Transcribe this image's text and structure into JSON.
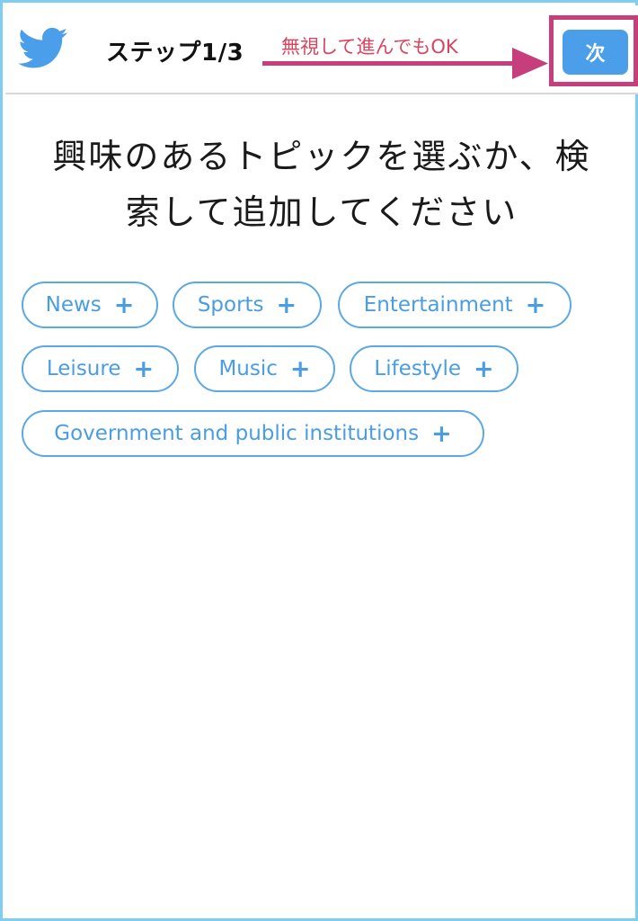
{
  "header": {
    "step_title": "ステップ1/3",
    "annotation": "無視して進んでもOK",
    "next_label": "次"
  },
  "heading": {
    "line1": "興味のあるトピックを選ぶか、検",
    "line2": "索して追加してください"
  },
  "topics": [
    {
      "label": "News",
      "plus": "+"
    },
    {
      "label": "Sports",
      "plus": "+"
    },
    {
      "label": "Entertainment",
      "plus": "+"
    },
    {
      "label": "Leisure",
      "plus": "+"
    },
    {
      "label": "Music",
      "plus": "+"
    },
    {
      "label": "Lifestyle",
      "plus": "+"
    },
    {
      "label": "Government and public institutions",
      "plus": "+"
    }
  ],
  "colors": {
    "accent": "#4a9eea",
    "frame": "#7fcdf0",
    "annotation": "#d9455f",
    "highlight": "#c73e7c"
  },
  "icons": {
    "logo": "twitter-bird-icon",
    "arrow": "right-arrow-annotation"
  }
}
